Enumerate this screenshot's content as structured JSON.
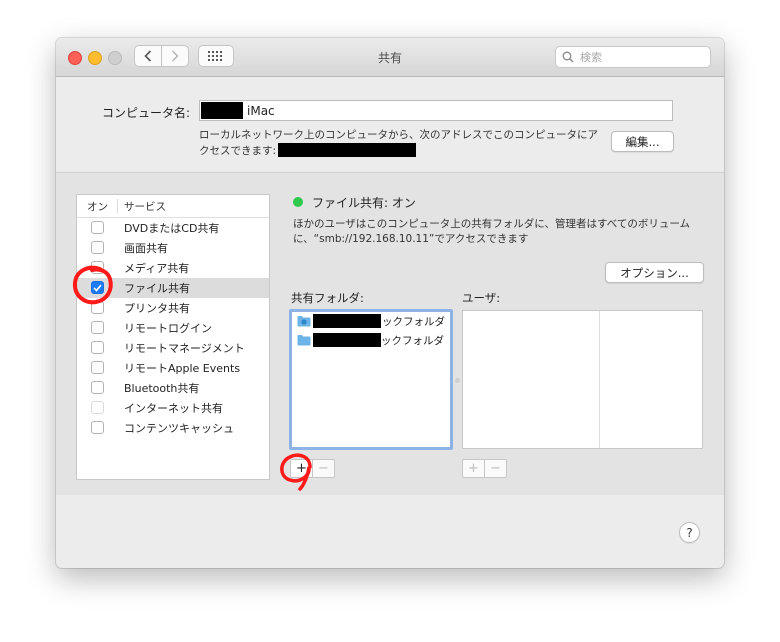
{
  "window": {
    "title": "共有",
    "search_placeholder": "検索"
  },
  "computer_name": {
    "label": "コンピュータ名:",
    "value": "iMac",
    "description": "ローカルネットワーク上のコンピュータから、次のアドレスでこのコンピュータにアクセスできます:",
    "edit_button": "編集..."
  },
  "services": {
    "header_on": "オン",
    "header_service": "サービス",
    "items": [
      {
        "label": "DVDまたはCD共有",
        "checked": false
      },
      {
        "label": "画面共有",
        "checked": false
      },
      {
        "label": "メディア共有",
        "checked": false
      },
      {
        "label": "ファイル共有",
        "checked": true,
        "selected": true
      },
      {
        "label": "プリンタ共有",
        "checked": false
      },
      {
        "label": "リモートログイン",
        "checked": false
      },
      {
        "label": "リモートマネージメント",
        "checked": false
      },
      {
        "label": "リモートApple Events",
        "checked": false
      },
      {
        "label": "Bluetooth共有",
        "checked": false
      },
      {
        "label": "インターネット共有",
        "checked": false,
        "disabled": true
      },
      {
        "label": "コンテンツキャッシュ",
        "checked": false
      }
    ]
  },
  "file_sharing": {
    "status": "ファイル共有: オン",
    "status_color": "#2ec94d",
    "description": "ほかのユーザはこのコンピュータ上の共有フォルダに、管理者はすべてのボリュームに、“smb://192.168.10.11”でアクセスできます",
    "options_button": "オプション...",
    "shared_folders_label": "共有フォルダ:",
    "users_label": "ユーザ:",
    "shared_folders": [
      {
        "suffix": "ックフォルダ",
        "icon": "public-folder-icon"
      },
      {
        "suffix": "ックフォルダ",
        "icon": "folder-icon"
      }
    ],
    "add_symbol": "+",
    "remove_symbol": "−"
  },
  "help": "?"
}
